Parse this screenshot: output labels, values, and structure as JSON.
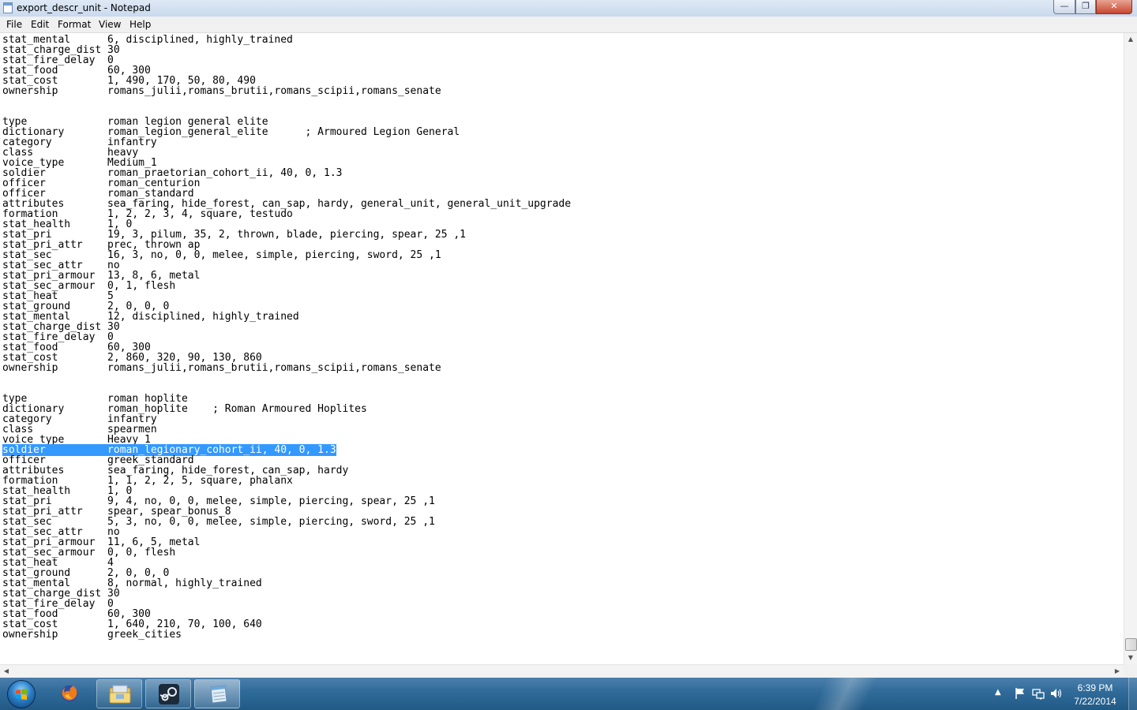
{
  "window": {
    "title": "export_descr_unit - Notepad",
    "controls": {
      "minimize": "—",
      "maximize": "❐",
      "close": "✕"
    }
  },
  "menu": [
    "File",
    "Edit",
    "Format",
    "View",
    "Help"
  ],
  "editor": {
    "selected_line_index": 40,
    "lines": [
      "stat_mental      6, disciplined, highly_trained",
      "stat_charge_dist 30",
      "stat_fire_delay  0",
      "stat_food        60, 300",
      "stat_cost        1, 490, 170, 50, 80, 490",
      "ownership        romans_julii,romans_brutii,romans_scipii,romans_senate",
      "",
      "",
      "type             roman legion general elite",
      "dictionary       roman_legion_general_elite      ; Armoured Legion General",
      "category         infantry",
      "class            heavy",
      "voice_type       Medium_1",
      "soldier          roman_praetorian_cohort_ii, 40, 0, 1.3",
      "officer          roman_centurion",
      "officer          roman_standard",
      "attributes       sea_faring, hide_forest, can_sap, hardy, general_unit, general_unit_upgrade",
      "formation        1, 2, 2, 3, 4, square, testudo",
      "stat_health      1, 0",
      "stat_pri         19, 3, pilum, 35, 2, thrown, blade, piercing, spear, 25 ,1",
      "stat_pri_attr    prec, thrown ap",
      "stat_sec         16, 3, no, 0, 0, melee, simple, piercing, sword, 25 ,1",
      "stat_sec_attr    no",
      "stat_pri_armour  13, 8, 6, metal",
      "stat_sec_armour  0, 1, flesh",
      "stat_heat        5",
      "stat_ground      2, 0, 0, 0",
      "stat_mental      12, disciplined, highly_trained",
      "stat_charge_dist 30",
      "stat_fire_delay  0",
      "stat_food        60, 300",
      "stat_cost        2, 860, 320, 90, 130, 860",
      "ownership        romans_julii,romans_brutii,romans_scipii,romans_senate",
      "",
      "",
      "type             roman hoplite",
      "dictionary       roman_hoplite    ; Roman Armoured Hoplites",
      "category         infantry",
      "class            spearmen",
      "voice_type       Heavy_1",
      "soldier          roman_legionary_cohort_ii, 40, 0, 1.3",
      "officer          greek_standard",
      "attributes       sea_faring, hide_forest, can_sap, hardy",
      "formation        1, 1, 2, 2, 5, square, phalanx",
      "stat_health      1, 0",
      "stat_pri         9, 4, no, 0, 0, melee, simple, piercing, spear, 25 ,1",
      "stat_pri_attr    spear, spear_bonus_8",
      "stat_sec         5, 3, no, 0, 0, melee, simple, piercing, sword, 25 ,1",
      "stat_sec_attr    no",
      "stat_pri_armour  11, 6, 5, metal",
      "stat_sec_armour  0, 0, flesh",
      "stat_heat        4",
      "stat_ground      2, 0, 0, 0",
      "stat_mental      8, normal, highly_trained",
      "stat_charge_dist 30",
      "stat_fire_delay  0",
      "stat_food        60, 300",
      "stat_cost        1, 640, 210, 70, 100, 640",
      "ownership        greek_cities"
    ]
  },
  "scrollbars": {
    "up": "▲",
    "down": "▼",
    "left": "◀",
    "right": "▶"
  },
  "taskbar": {
    "apps": [
      "firefox-icon",
      "windows-explorer-icon",
      "steam-icon",
      "notepad-icon"
    ],
    "tray_expand": "▲",
    "clock_time": "6:39 PM",
    "clock_date": "7/22/2014"
  },
  "colors": {
    "selection": "#3399ff",
    "taskbar": "#2f6a99"
  }
}
